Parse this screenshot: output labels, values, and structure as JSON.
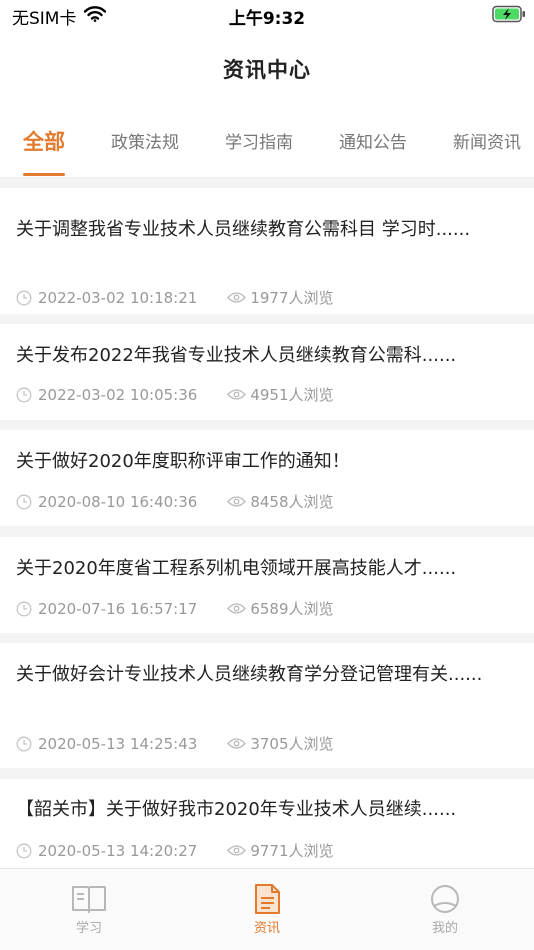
{
  "status_bar": {
    "carrier": "无SIM卡",
    "time": "上午9:32",
    "icons": [
      "wifi-icon",
      "battery-charging-icon"
    ]
  },
  "header": {
    "title": "资讯中心"
  },
  "tabs": [
    {
      "label": "全部",
      "active": true
    },
    {
      "label": "政策法规",
      "active": false
    },
    {
      "label": "学习指南",
      "active": false
    },
    {
      "label": "通知公告",
      "active": false
    },
    {
      "label": "新闻资讯",
      "active": false
    }
  ],
  "news": [
    {
      "title": "关于调整我省专业技术人员继续教育公需科目 学习时......",
      "date": "2022-03-02 10:18:21",
      "views": "1977人浏览"
    },
    {
      "title": "关于发布2022年我省专业技术人员继续教育公需科......",
      "date": "2022-03-02 10:05:36",
      "views": "4951人浏览"
    },
    {
      "title": "关于做好2020年度职称评审工作的通知！",
      "date": "2020-08-10 16:40:36",
      "views": "8458人浏览"
    },
    {
      "title": "关于2020年度省工程系列机电领域开展高技能人才......",
      "date": "2020-07-16 16:57:17",
      "views": "6589人浏览"
    },
    {
      "title": "关于做好会计专业技术人员继续教育学分登记管理有关......",
      "date": "2020-05-13 14:25:43",
      "views": "3705人浏览"
    },
    {
      "title": "【韶关市】关于做好我市2020年专业技术人员继续......",
      "date": "2020-05-13 14:20:27",
      "views": "9771人浏览"
    }
  ],
  "bottom_nav": [
    {
      "label": "学习",
      "icon": "book-icon",
      "active": false
    },
    {
      "label": "资讯",
      "icon": "document-icon",
      "active": true
    },
    {
      "label": "我的",
      "icon": "profile-icon",
      "active": false
    }
  ],
  "colors": {
    "accent": "#e47a2e",
    "muted": "#999999",
    "background": "#f4f4f4"
  }
}
